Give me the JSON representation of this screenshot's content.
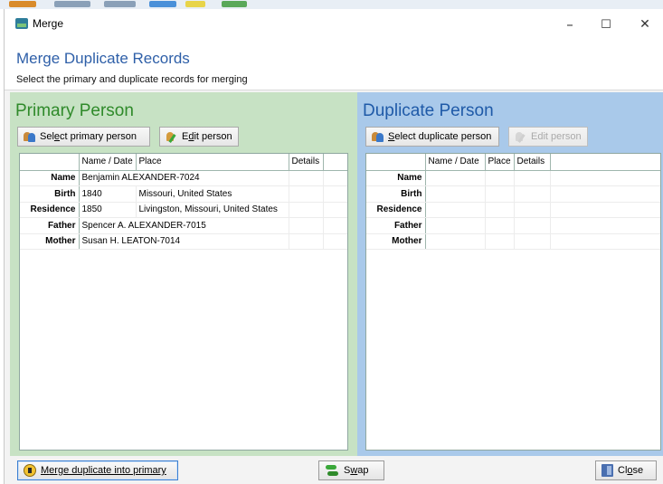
{
  "window": {
    "title": "Merge",
    "minimize_glyph": "–",
    "maximize_glyph": "☐",
    "close_glyph": "✕"
  },
  "header": {
    "title": "Merge Duplicate Records",
    "subtitle": "Select the primary and duplicate records for merging"
  },
  "primary": {
    "title": "Primary Person",
    "select_button": {
      "pre": "Sel",
      "accel": "e",
      "post": "ct primary person"
    },
    "edit_button": {
      "pre": "E",
      "accel": "d",
      "post": "it person"
    },
    "columns": [
      "",
      "Name / Date",
      "Place",
      "Details",
      ""
    ],
    "rows": [
      {
        "label": "Name",
        "name_date": "Benjamin ALEXANDER-7024",
        "place": "",
        "details": ""
      },
      {
        "label": "Birth",
        "name_date": "1840",
        "place": "Missouri, United States",
        "details": ""
      },
      {
        "label": "Residence",
        "name_date": "1850",
        "place": "Livingston, Missouri, United States",
        "details": ""
      },
      {
        "label": "Father",
        "name_date": "Spencer A. ALEXANDER-7015",
        "place": "",
        "details": ""
      },
      {
        "label": "Mother",
        "name_date": "Susan H. LEATON-7014",
        "place": "",
        "details": ""
      }
    ]
  },
  "duplicate": {
    "title": "Duplicate Person",
    "select_button": {
      "pre": "",
      "accel": "S",
      "post": "elect duplicate person"
    },
    "edit_button": {
      "pre": "",
      "accel": "",
      "post": "Edit person"
    },
    "columns": [
      "",
      "Name / Date",
      "Place",
      "Details",
      ""
    ],
    "rows": [
      {
        "label": "Name",
        "name_date": "",
        "place": "",
        "details": ""
      },
      {
        "label": "Birth",
        "name_date": "",
        "place": "",
        "details": ""
      },
      {
        "label": "Residence",
        "name_date": "",
        "place": "",
        "details": ""
      },
      {
        "label": "Father",
        "name_date": "",
        "place": "",
        "details": ""
      },
      {
        "label": "Mother",
        "name_date": "",
        "place": "",
        "details": ""
      }
    ]
  },
  "footer": {
    "merge_button": {
      "pre": "",
      "accel": "M",
      "post": "erge duplicate into primary"
    },
    "swap_button": {
      "pre": "S",
      "accel": "w",
      "post": "ap"
    },
    "close_button": {
      "pre": "Cl",
      "accel": "o",
      "post": "se"
    }
  },
  "colors": {
    "primary_panel": "#c7e2c4",
    "duplicate_panel": "#a9c9ea",
    "primary_title": "#2f8a2a",
    "duplicate_title": "#1f5aa8",
    "header_title": "#2e5fa8"
  }
}
